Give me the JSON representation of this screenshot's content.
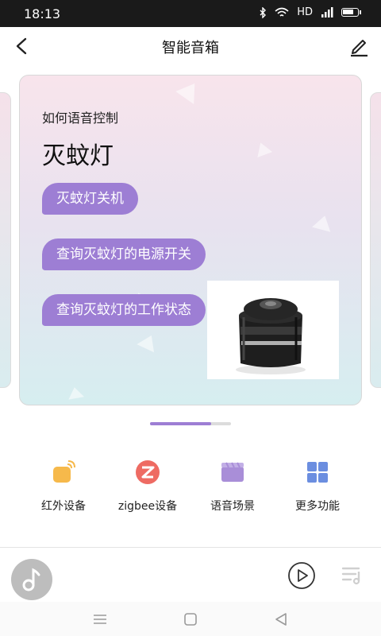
{
  "status": {
    "time": "18:13",
    "network": "HD",
    "battery_level": 0.75,
    "icons": [
      "bluetooth-icon",
      "wifi-icon",
      "signal-icon",
      "battery-icon"
    ]
  },
  "header": {
    "title": "智能音箱",
    "back_icon": "chevron-left-icon",
    "edit_icon": "edit-icon"
  },
  "card": {
    "subtitle": "如何语音控制",
    "device": "灭蚊灯",
    "commands": [
      "灭蚊灯关机",
      "查询灭蚊灯的电源开关",
      "查询灭蚊灯的工作状态"
    ],
    "image": "mosquito-lamp-image"
  },
  "carousel": {
    "active_fraction": 0.75
  },
  "functions": [
    {
      "label": "红外设备",
      "icon": "infrared-device-icon",
      "color": "#f6b94b"
    },
    {
      "label": "zigbee设备",
      "icon": "zigbee-icon",
      "color": "#ee6b63"
    },
    {
      "label": "语音场景",
      "icon": "voice-scene-icon",
      "color": "#a98ed8"
    },
    {
      "label": "更多功能",
      "icon": "more-grid-icon",
      "color": "#6b8ee0"
    }
  ],
  "player": {
    "disc_icon": "music-note-icon",
    "play_icon": "play-icon",
    "list_icon": "playlist-icon"
  },
  "colors": {
    "accent": "#9d7ed4",
    "status_bar": "#1a1a1a"
  }
}
